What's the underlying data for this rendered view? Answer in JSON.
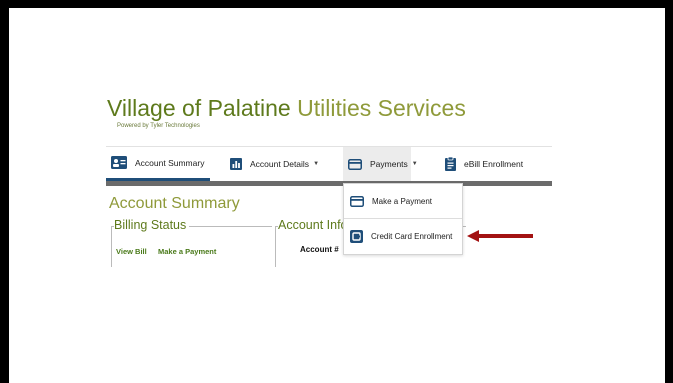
{
  "header": {
    "title_part1": "Village of Palatine",
    "title_part2": "Utilities Services",
    "powered_by": "Powered by Tyler Technologies"
  },
  "nav": {
    "items": [
      {
        "label": "Account Summary",
        "icon": "account-card-icon",
        "active": true
      },
      {
        "label": "Account Details",
        "icon": "bar-chart-icon",
        "has_caret": true
      },
      {
        "label": "Payments",
        "icon": "credit-card-icon",
        "has_caret": true,
        "open": true
      },
      {
        "label": "eBill Enrollment",
        "icon": "document-icon"
      }
    ],
    "caret": "▼"
  },
  "payments_menu": {
    "items": [
      {
        "label": "Make a Payment",
        "icon": "credit-card-icon"
      },
      {
        "label": "Credit Card Enrollment",
        "icon": "card-enroll-icon"
      }
    ]
  },
  "main": {
    "section_title": "Account Summary",
    "billing_status": {
      "title": "Billing Status",
      "links": [
        "View Bill",
        "Make a Payment"
      ]
    },
    "account_info": {
      "title": "Account Information",
      "account_label": "Account #"
    }
  },
  "colors": {
    "brand_green": "#5e7a1c",
    "accent_olive": "#8f9a3a",
    "nav_icon_blue": "#1f4e79",
    "arrow_red": "#a31212"
  }
}
